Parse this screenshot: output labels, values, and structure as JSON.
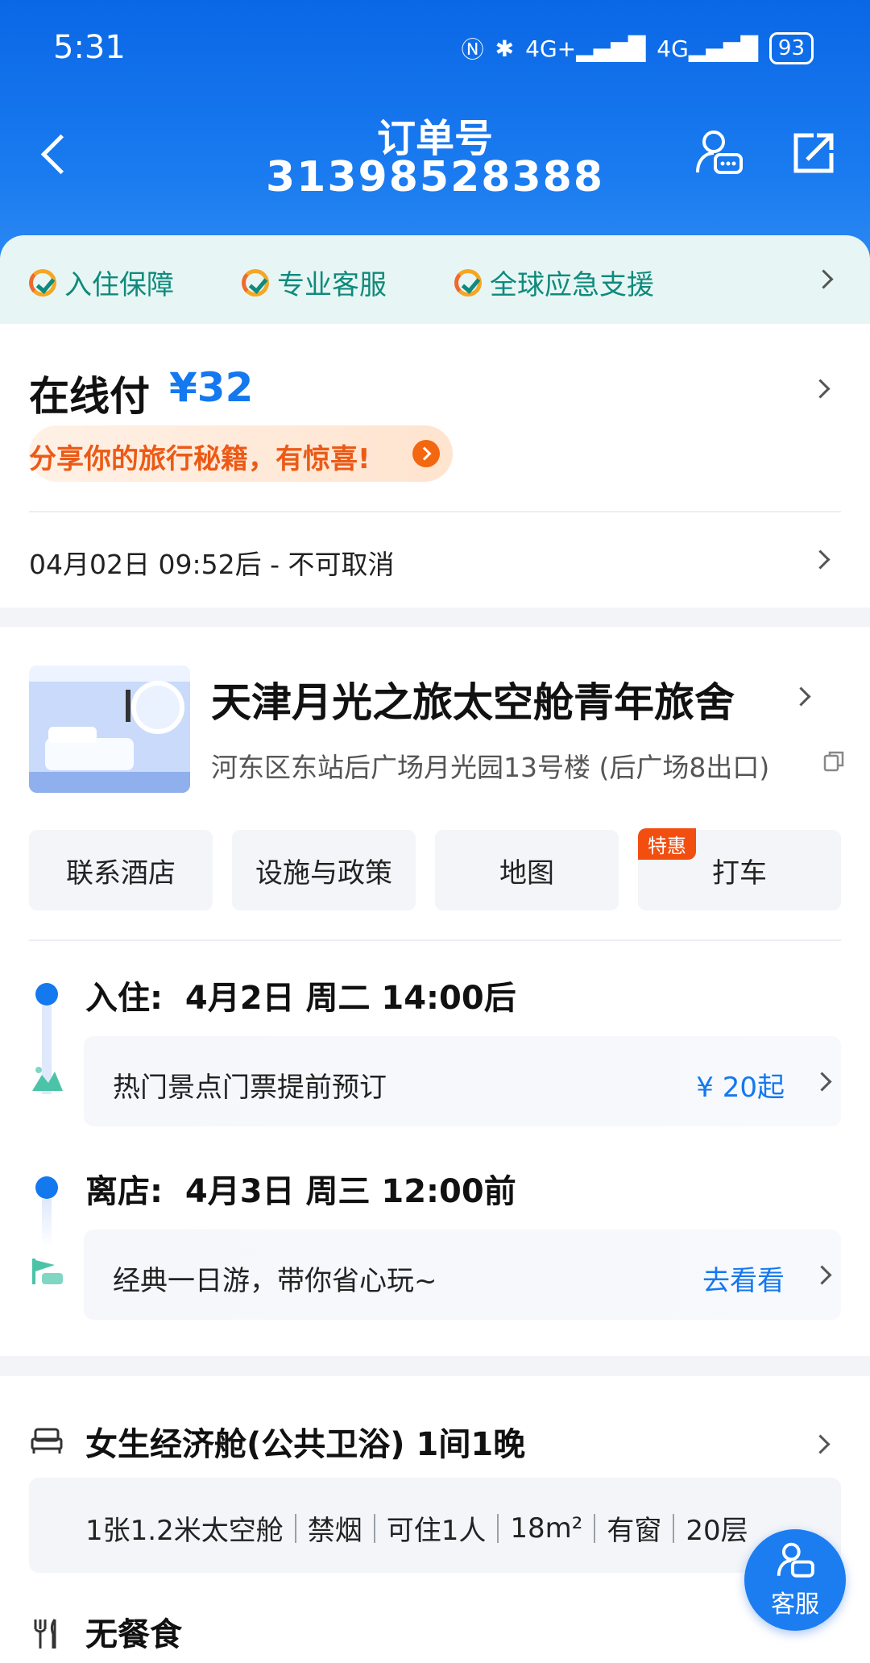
{
  "status_bar": {
    "time": "5:31",
    "network_1": "4G+",
    "network_2": "4G",
    "battery": "93"
  },
  "header": {
    "title": "订单号",
    "order_number": "31398528388"
  },
  "guarantee": {
    "items": [
      "入住保障",
      "专业客服",
      "全球应急支援"
    ]
  },
  "payment": {
    "label": "在线付",
    "amount": "¥32",
    "share_banner": "分享你的旅行秘籍，有惊喜!",
    "cancel_policy": "04月02日 09:52后 - 不可取消"
  },
  "hotel": {
    "name": "天津月光之旅太空舱青年旅舍",
    "address": "河东区东站后广场月光园13号楼 (后广场8出口)",
    "actions": [
      "联系酒店",
      "设施与政策",
      "地图",
      "打车"
    ],
    "deal_badge": "特惠",
    "checkin_label": "入住:",
    "checkin_value": "4月2日 周二 14:00后",
    "checkout_label": "离店:",
    "checkout_value": "4月3日 周三 12:00前",
    "promo_tickets": {
      "text": "热门景点门票提前预订",
      "right": "¥ 20起"
    },
    "promo_tour": {
      "text": "经典一日游，带你省心玩~",
      "right": "去看看"
    }
  },
  "room": {
    "title": "女生经济舱(公共卫浴) 1间1晚",
    "specs": [
      "1张1.2米太空舱",
      "禁烟",
      "可住1人",
      "18m²",
      "有窗",
      "20层"
    ],
    "meal": "无餐食"
  },
  "floating_cs": {
    "label": "客服"
  },
  "colors": {
    "primary": "#1478ef",
    "accent_orange": "#ec5a16",
    "guarantee_green": "#0f8a7c"
  }
}
